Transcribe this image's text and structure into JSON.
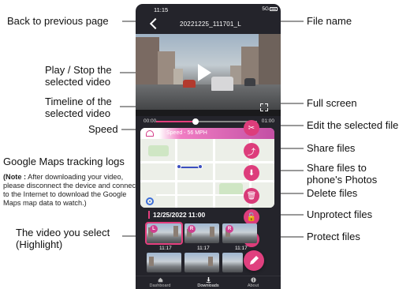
{
  "labels": {
    "back": "Back to previous page",
    "play_stop": "Play / Stop the selected video",
    "timeline": "Timeline of the selected video",
    "speed": "Speed",
    "maps_tracking": "Google Maps tracking logs",
    "note_prefix": "(Note :",
    "note_body": "After downloading your video, please disconnect the device and connect to the Internet to download the Google Maps map data to watch.)",
    "video_you_select": "The video you select (Highlight)",
    "file_name": "File name",
    "full_screen": "Full screen",
    "edit_file": "Edit the selected file",
    "share_files": "Share files",
    "share_photos": "Share files to phone's Photos",
    "delete_files": "Delete files",
    "unprotect_files": "Unprotect files",
    "protect_files": "Protect files"
  },
  "phone": {
    "status_time": "11:15",
    "status_signal": "5G",
    "file_name": "20221225_111701_L",
    "time_start": "00:00",
    "time_end": "01:00",
    "progress": 0.39,
    "speed_text": "Speed - 56 MPH",
    "date_header": "12/25/2022 11:00",
    "thumbnails": [
      {
        "badge": "L",
        "time": "11:17",
        "selected": true
      },
      {
        "badge": "R",
        "time": "11:17",
        "selected": false
      },
      {
        "badge": "R",
        "time": "11:17",
        "selected": false
      },
      {
        "badge": "",
        "time": "",
        "selected": false
      },
      {
        "badge": "",
        "time": "",
        "selected": false
      },
      {
        "badge": "",
        "time": "",
        "selected": false
      }
    ],
    "nav": [
      "Dashboard",
      "Downloads",
      "About"
    ]
  },
  "colors": {
    "accent": "#e43e7d",
    "phone_bg": "#24242b",
    "route": "#3c4fbf"
  }
}
